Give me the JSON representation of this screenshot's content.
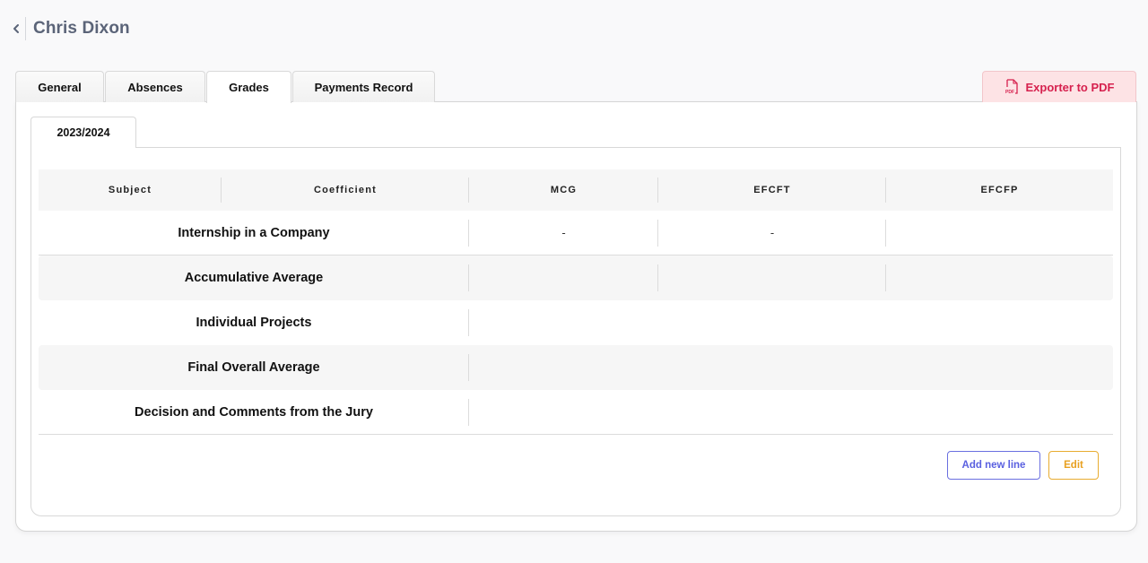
{
  "header": {
    "back_icon": "chevron-left-icon",
    "title": "Chris Dixon"
  },
  "tabs": [
    {
      "label": "General",
      "active": false
    },
    {
      "label": "Absences",
      "active": false
    },
    {
      "label": "Grades",
      "active": true
    },
    {
      "label": "Payments Record",
      "active": false
    }
  ],
  "export": {
    "icon": "pdf-file-icon",
    "icon_text": "PDF",
    "label": "Exporter to PDF",
    "color": "#d6214e",
    "background": "#fde3e5"
  },
  "year_tabs": [
    {
      "label": "2023/2024",
      "active": true
    }
  ],
  "table": {
    "columns": [
      "Subject",
      "Coefficient",
      "MCG",
      "EFCFT",
      "EFCFP"
    ],
    "rows": [
      {
        "subject": "Internship in a Company",
        "mcg": "-",
        "efcft": "-",
        "efcfp": ""
      },
      {
        "subject": "Accumulative Average",
        "mcg": "",
        "efcft": "",
        "efcfp": ""
      },
      {
        "subject": "Individual Projects"
      },
      {
        "subject": "Final Overall Average"
      },
      {
        "subject": "Decision and Comments from the Jury"
      }
    ]
  },
  "actions": {
    "add_label": "Add new line",
    "edit_label": "Edit",
    "add_color": "#5a60e0",
    "edit_color": "#e8a020"
  }
}
